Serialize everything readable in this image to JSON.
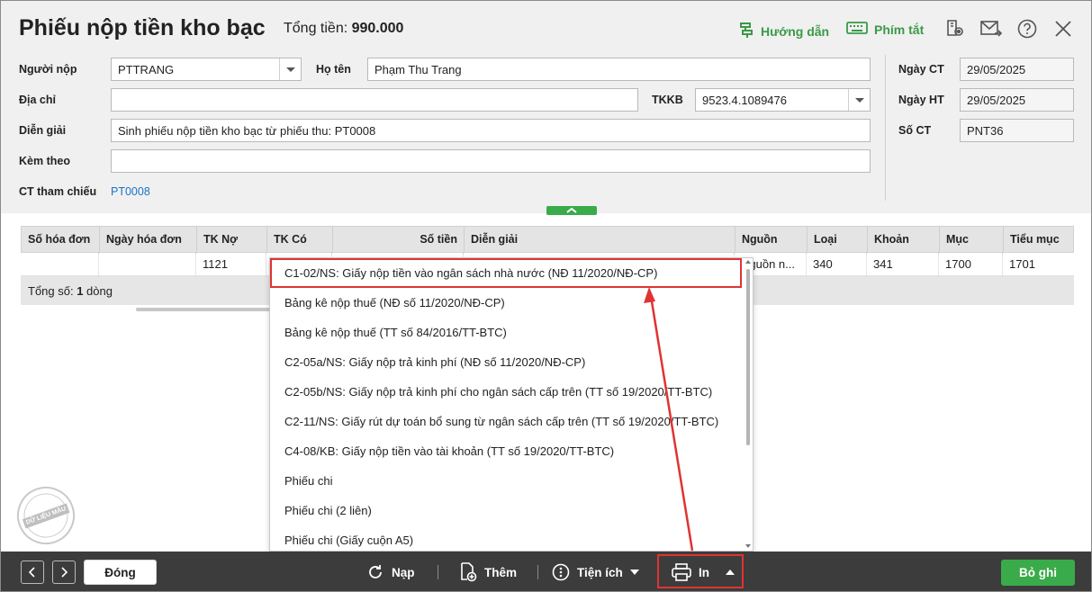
{
  "header": {
    "title": "Phiếu nộp tiền kho bạc",
    "total_label": "Tổng tiền:",
    "total_value": "990.000",
    "guide_label": "Hướng dẫn",
    "shortcut_label": "Phím tắt",
    "accent": "#3a9a46"
  },
  "form": {
    "payer_label": "Người nộp",
    "payer_value": "PTTRANG",
    "name_label": "Họ tên",
    "name_value": "Phạm Thu Trang",
    "address_label": "Địa chỉ",
    "address_value": "",
    "tkkb_label": "TKKB",
    "tkkb_value": "9523.4.1089476",
    "desc_label": "Diễn giải",
    "desc_value": "Sinh phiếu nộp tiền kho bạc từ phiếu thu: PT0008",
    "attach_label": "Kèm theo",
    "attach_value": "",
    "ref_label": "CT tham chiếu",
    "ref_value": "PT0008",
    "date_ct_label": "Ngày CT",
    "date_ct_value": "29/05/2025",
    "date_ht_label": "Ngày HT",
    "date_ht_value": "29/05/2025",
    "doc_no_label": "Số CT",
    "doc_no_value": "PNT36"
  },
  "grid": {
    "columns": [
      "Số hóa đơn",
      "Ngày hóa đơn",
      "TK Nợ",
      "TK Có",
      "Số tiền",
      "Diễn giải",
      "Nguồn",
      "Loại",
      "Khoản",
      "Mục",
      "Tiểu mục"
    ],
    "rows": [
      [
        "",
        "",
        "1121",
        "",
        "",
        "",
        "Nguồn n...",
        "340",
        "341",
        "1700",
        "1701"
      ]
    ],
    "summary_prefix": "Tổng số: ",
    "summary_count": "1",
    "summary_suffix": " dòng"
  },
  "print_menu": {
    "items": [
      "C1-02/NS: Giấy nộp tiền vào ngân sách nhà nước (NĐ 11/2020/NĐ-CP)",
      "Bảng kê nộp thuế (NĐ số 11/2020/NĐ-CP)",
      "Bảng kê nộp thuế (TT số 84/2016/TT-BTC)",
      "C2-05a/NS: Giấy nộp trả kinh phí (NĐ số 11/2020/NĐ-CP)",
      "C2-05b/NS: Giấy nộp trả kinh phí cho ngân sách cấp trên (TT số 19/2020/TT-BTC)",
      "C2-11/NS: Giấy rút dự toán bổ sung từ ngân sách cấp trên (TT số 19/2020/TT-BTC)",
      "C4-08/KB: Giấy nộp tiền vào tài khoản (TT số 19/2020/TT-BTC)",
      "Phiếu chi",
      "Phiếu chi (2 liên)",
      "Phiếu chi (Giấy cuộn A5)"
    ],
    "highlighted_index": 0,
    "highlight_color": "#e03333"
  },
  "watermark": {
    "text": "DỮ LIỆU MẪU"
  },
  "footer": {
    "close_label": "Đóng",
    "reload_label": "Nạp",
    "add_label": "Thêm",
    "utility_label": "Tiện ích",
    "print_label": "In",
    "discard_label": "Bỏ ghi"
  }
}
